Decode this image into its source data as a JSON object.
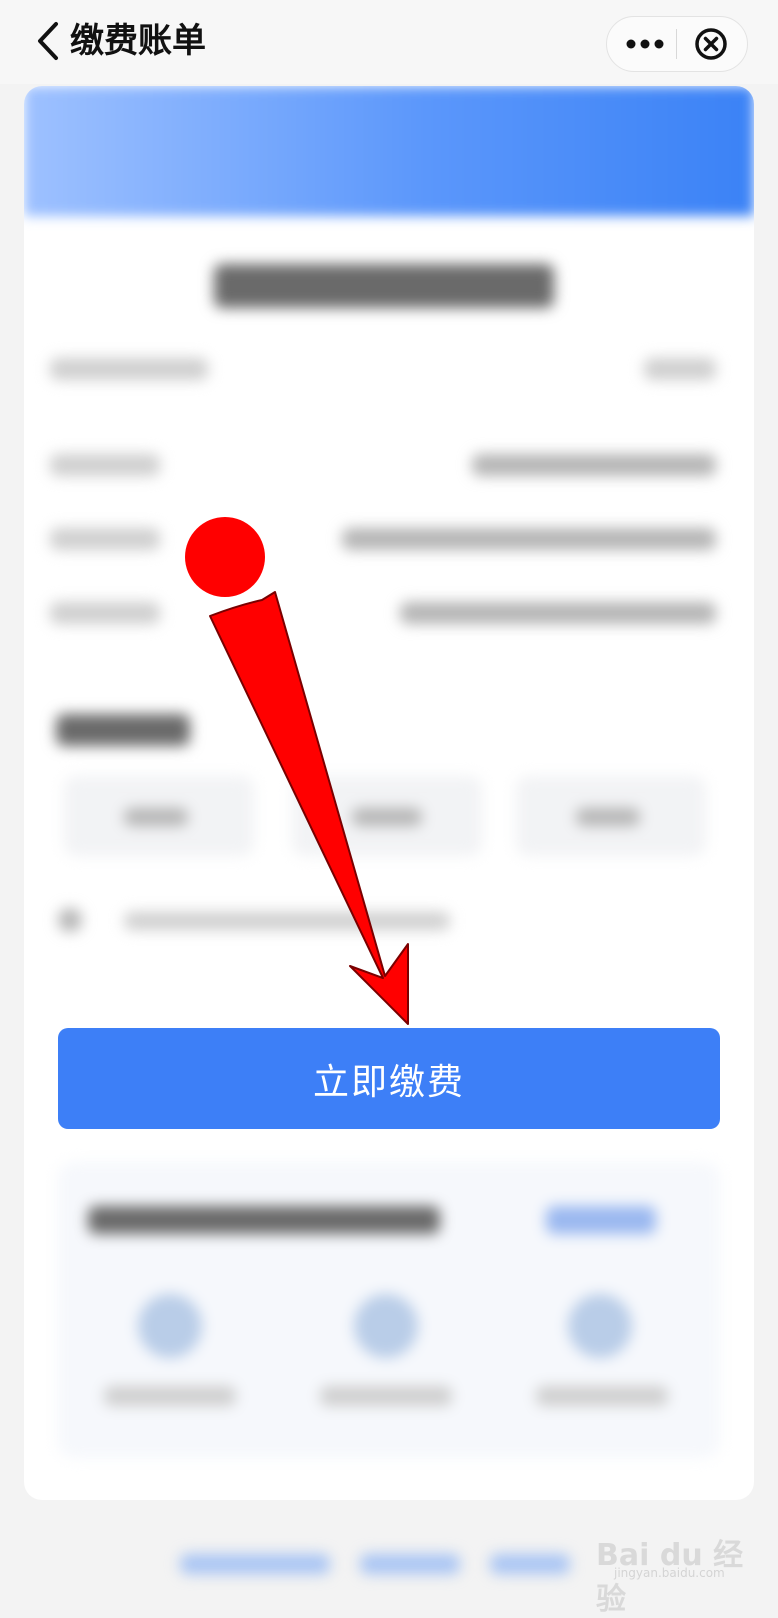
{
  "header": {
    "title": "缴费账单"
  },
  "main": {
    "pay_button_label": "立即缴费"
  },
  "watermark": {
    "brand": "Bai du 经验",
    "sub": "jingyan.baidu.com"
  },
  "colors": {
    "accent": "#3d7ff7",
    "annotation": "#ff0000"
  },
  "icons": [
    "back-arrow-icon",
    "more-dots-icon",
    "close-circle-icon",
    "annotation-arrow-icon"
  ]
}
